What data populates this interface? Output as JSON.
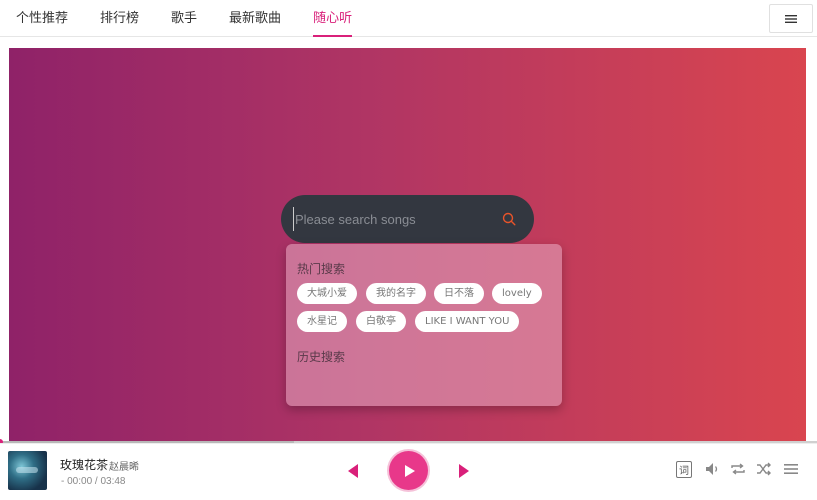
{
  "nav": {
    "tabs": [
      {
        "label": "个性推荐"
      },
      {
        "label": "排行榜"
      },
      {
        "label": "歌手"
      },
      {
        "label": "最新歌曲"
      },
      {
        "label": "随心听"
      }
    ],
    "active_tab": "随心听"
  },
  "search": {
    "placeholder": "Please search songs"
  },
  "dropdown": {
    "hot_title": "热门搜索",
    "hot_items": [
      "大城小爱",
      "我的名字",
      "日不落",
      "lovely",
      "水星记",
      "白敬亭",
      "LIKE I WANT YOU"
    ],
    "history_title": "历史搜索"
  },
  "player": {
    "title": "玫瑰花茶",
    "artist": "赵晨晞",
    "time": "- 00:00 / 03:48",
    "lyric_label": "词",
    "progress": 0.0,
    "buffered": 0.36
  },
  "colors": {
    "accent": "#d9207a",
    "gradient_start": "#8f2268",
    "gradient_end": "#d9454f",
    "play_button": "#e8388a"
  },
  "icons": [
    "menu-icon",
    "search-icon",
    "prev-icon",
    "play-icon",
    "next-icon",
    "volume-icon",
    "loop-icon",
    "shuffle-icon",
    "playlist-icon"
  ]
}
